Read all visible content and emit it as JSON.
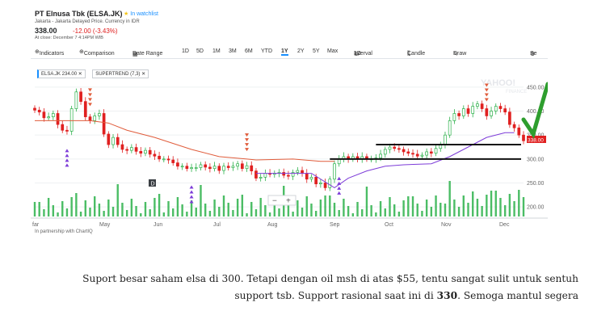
{
  "header": {
    "stock_title": "PT Elnusa Tbk (ELSA.JK)",
    "watchlist_label": "In watchlist",
    "exchange_info": "Jakarta - Jakarta Delayed Price. Currency in IDR",
    "price": "338.00",
    "change": "-12.00 (-3.43%)",
    "close_info": "At close: December 7 4:14PM WIB"
  },
  "toolbar": {
    "indicators": "Indicators",
    "comparison": "Comparison",
    "date_range": "Date Range",
    "ranges": [
      "1D",
      "5D",
      "1M",
      "3M",
      "6M",
      "YTD",
      "1Y",
      "2Y",
      "5Y",
      "Max"
    ],
    "selected_range": "1Y",
    "interval": "Interval",
    "interval_value": "1D",
    "chart_style": "Candle",
    "draw": "Draw",
    "settings_cut": "Se"
  },
  "legend_tags": {
    "symbol_tag": "ELSA.JK 234.00",
    "indicator_tag": "SUPERTREND (7,3)"
  },
  "watermark": {
    "line1": "YAHOO!",
    "line2": "FINANCE"
  },
  "zoom": {
    "minus": "−",
    "plus": "+"
  },
  "marker_d": "D",
  "partner_text": "In partnership with ChartIQ",
  "current_price_label": "338.00",
  "colors": {
    "up_candle": "#2cb14a",
    "down_candle": "#e02020",
    "supertrend_down": "#e05c3b",
    "supertrend_up": "#7d3cd8",
    "arrow_down": "#e05c3b",
    "arrow_up": "#7d3cd8",
    "volume": "#2cb14a",
    "accent": "#188fff",
    "checkmark": "#2e9e2e"
  },
  "chart_data": {
    "type": "candlestick",
    "x_ticks": [
      "far",
      "May",
      "Jun",
      "Jul",
      "Aug",
      "Sep",
      "Oct",
      "Nov",
      "Dec"
    ],
    "y_ticks": [
      200,
      250,
      300,
      350,
      400,
      450
    ],
    "ylim": [
      180,
      470
    ],
    "close_series": [
      402,
      398,
      386,
      388,
      395,
      372,
      360,
      358,
      405,
      440,
      420,
      388,
      380,
      390,
      395,
      352,
      330,
      345,
      330,
      320,
      318,
      324,
      316,
      312,
      318,
      310,
      306,
      300,
      300,
      298,
      292,
      285,
      285,
      280,
      282,
      282,
      288,
      283,
      280,
      285,
      276,
      285,
      282,
      285,
      290,
      280,
      286,
      275,
      260,
      262,
      270,
      268,
      270,
      272,
      266,
      264,
      272,
      276,
      270,
      258,
      262,
      248,
      250,
      240,
      258,
      290,
      300,
      305,
      300,
      305,
      300,
      305,
      300,
      300,
      302,
      310,
      320,
      325,
      322,
      320,
      315,
      312,
      310,
      306,
      308,
      315,
      312,
      322,
      330,
      350,
      380,
      395,
      390,
      405,
      395,
      410,
      415,
      405,
      390,
      400,
      410,
      405,
      398,
      372,
      365,
      350,
      338
    ],
    "supertrend": {
      "down_segments": [
        [
          0,
          380
        ],
        [
          12,
          380
        ],
        [
          16,
          375
        ],
        [
          20,
          360
        ],
        [
          26,
          345
        ],
        [
          34,
          320
        ],
        [
          40,
          305
        ],
        [
          46,
          300
        ],
        [
          48,
          298
        ],
        [
          56,
          300
        ],
        [
          62,
          295
        ],
        [
          65,
          295
        ]
      ],
      "up_segments": [
        [
          48,
          270
        ],
        [
          60,
          270
        ],
        [
          65,
          240
        ],
        [
          68,
          260
        ],
        [
          72,
          275
        ],
        [
          76,
          285
        ],
        [
          80,
          288
        ],
        [
          86,
          290
        ],
        [
          90,
          305
        ],
        [
          94,
          325
        ],
        [
          98,
          345
        ],
        [
          102,
          355
        ],
        [
          104,
          355
        ]
      ]
    },
    "support_lines": [
      300,
      330
    ],
    "last_price": 338
  },
  "caption": {
    "line1": "Suport besar saham elsa di 300. Tetapi dengan oil msh di atas $55, tentu sangat sulit untuk sentuh",
    "line2_pre": "support tsb. Support rasional saat ini di ",
    "line2_bold": "330",
    "line2_post": ". Semoga mantul segera"
  }
}
